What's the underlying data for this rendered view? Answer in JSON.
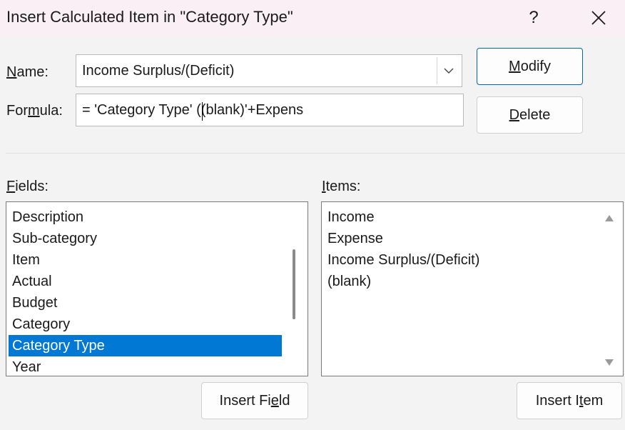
{
  "window": {
    "title": "Insert Calculated Item in \"Category Type\"",
    "help_glyph": "?",
    "close_icon": "close-icon"
  },
  "name": {
    "label_underlined": "N",
    "label_rest": "ame:",
    "value": "Income Surplus/(Deficit)"
  },
  "formula": {
    "label_pre": "For",
    "label_underlined": "m",
    "label_rest": "ula:",
    "value": "= 'Category Type' ((blank)'+Expens"
  },
  "buttons": {
    "modify_underlined": "M",
    "modify_rest": "odify",
    "delete_underlined": "D",
    "delete_rest": "elete",
    "insert_field_pre": "Insert Fi",
    "insert_field_underlined": "e",
    "insert_field_rest": "ld",
    "insert_item_pre": "Insert I",
    "insert_item_underlined": "t",
    "insert_item_rest": "em"
  },
  "fields": {
    "label_underlined": "F",
    "label_rest": "ields:",
    "items": [
      "Description",
      "Sub-category",
      "Item",
      "Actual",
      "Budget",
      "Category",
      "Category Type",
      "Year"
    ],
    "selected": "Category Type"
  },
  "items": {
    "label_underlined": "I",
    "label_rest": "tems:",
    "items": [
      "Income",
      "Expense",
      "Income Surplus/(Deficit)",
      "(blank)"
    ]
  },
  "colors": {
    "selection": "#0078d4",
    "primary_border": "#0067c0",
    "titlebar": "#f9eff4"
  }
}
